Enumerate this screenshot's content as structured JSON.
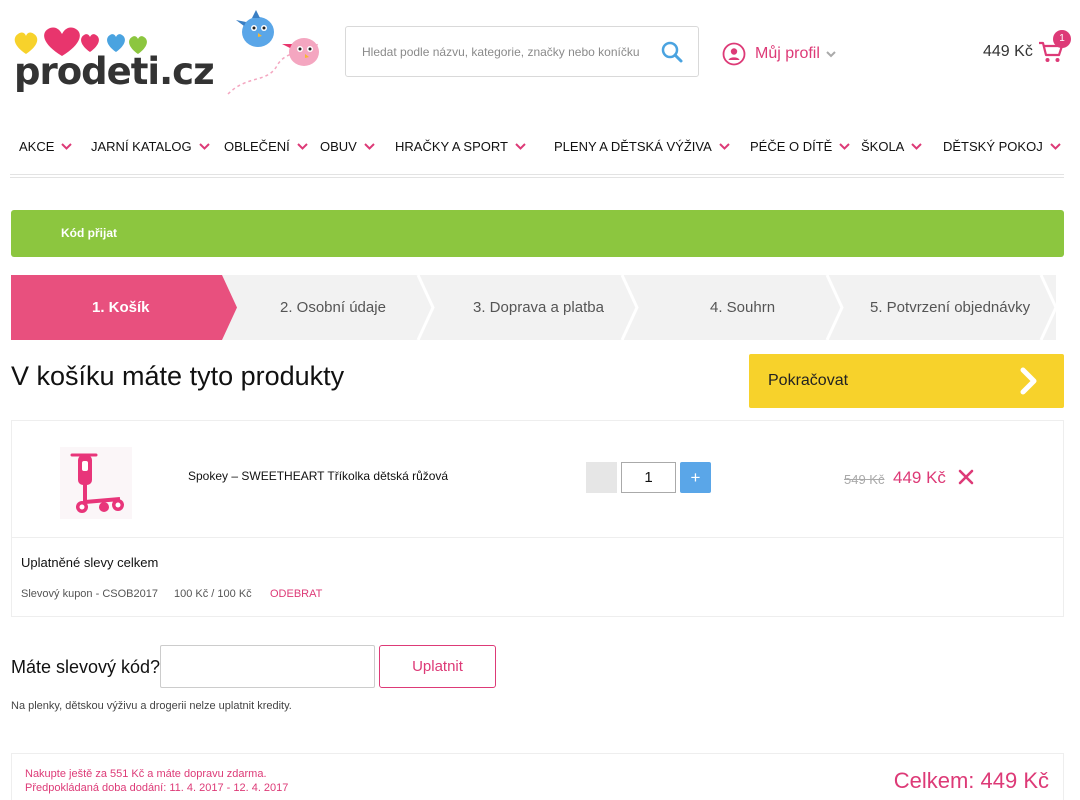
{
  "header": {
    "logo_text": "prodeti.cz",
    "search_placeholder": "Hledat podle názvu, kategorie, značky nebo koníčku",
    "profile_label": "Můj profil",
    "cart_total": "449 Kč",
    "cart_count": "1"
  },
  "nav": {
    "items": [
      {
        "label": "AKCE"
      },
      {
        "label": "JARNÍ KATALOG"
      },
      {
        "label": "OBLEČENÍ"
      },
      {
        "label": "OBUV"
      },
      {
        "label": "HRAČKY A SPORT"
      },
      {
        "label": "PLENY A DĚTSKÁ VÝŽIVA"
      },
      {
        "label": "PÉČE O DÍTĚ"
      },
      {
        "label": "ŠKOLA"
      },
      {
        "label": "DĚTSKÝ POKOJ"
      }
    ]
  },
  "banner": {
    "text": "Kód přijat"
  },
  "steps": [
    {
      "label": "1. Košík",
      "active": true
    },
    {
      "label": "2. Osobní údaje",
      "active": false
    },
    {
      "label": "3. Doprava a platba",
      "active": false
    },
    {
      "label": "4. Souhrn",
      "active": false
    },
    {
      "label": "5. Potvrzení objednávky",
      "active": false
    }
  ],
  "cart": {
    "heading": "V košíku máte tyto produkty",
    "continue_label": "Pokračovat",
    "product": {
      "name": "Spokey – SWEETHEART Tříkolka dětská růžová",
      "quantity": "1",
      "plus_label": "+",
      "price_old": "549 Kč",
      "price_new": "449 Kč"
    },
    "discounts": {
      "title": "Uplatněné slevy celkem",
      "coupon": "Slevový kupon - CSOB2017",
      "amount": "100 Kč / 100 Kč",
      "remove_label": "ODEBRAT"
    }
  },
  "coupon": {
    "label": "Máte slevový kód?",
    "button_label": "Uplatnit",
    "note": "Na plenky, dětskou výživu a drogerii nelze uplatnit kredity."
  },
  "summary": {
    "shipping_note": "Nakupte ještě za 551 Kč a máte dopravu zdarma.",
    "delivery_note": "Předpokládaná doba dodání: 11. 4. 2017 - 12. 4. 2017",
    "total": "Celkem: 449 Kč"
  },
  "colors": {
    "brand_pink": "#dd3a77",
    "success_green": "#8cc63f",
    "cta_yellow": "#f7d22b",
    "accent_blue": "#5aa6e8"
  }
}
